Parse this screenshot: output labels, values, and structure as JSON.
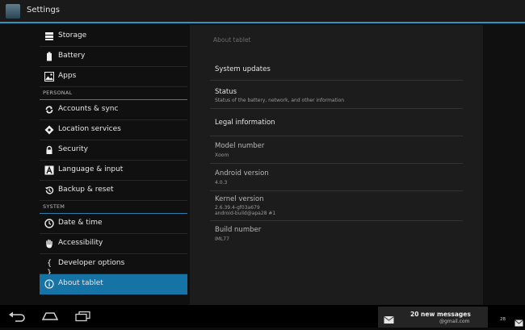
{
  "title": "Settings",
  "sidebar": {
    "items_a": [
      {
        "label": "Storage",
        "icon": "storage-icon"
      },
      {
        "label": "Battery",
        "icon": "battery-icon"
      },
      {
        "label": "Apps",
        "icon": "apps-icon"
      }
    ],
    "section_personal": "PERSONAL",
    "items_b": [
      {
        "label": "Accounts & sync",
        "icon": "sync-icon"
      },
      {
        "label": "Location services",
        "icon": "location-icon"
      },
      {
        "label": "Security",
        "icon": "lock-icon"
      },
      {
        "label": "Language & input",
        "icon": "language-icon"
      },
      {
        "label": "Backup & reset",
        "icon": "backup-icon"
      }
    ],
    "section_system": "SYSTEM",
    "items_c": [
      {
        "label": "Date & time",
        "icon": "clock-icon"
      },
      {
        "label": "Accessibility",
        "icon": "hand-icon"
      },
      {
        "label": "Developer options",
        "icon": "braces-icon"
      },
      {
        "label": "About tablet",
        "icon": "info-icon"
      }
    ]
  },
  "about": {
    "title": "About tablet",
    "system_updates": "System updates",
    "status_title": "Status",
    "status_sub": "Status of the battery, network, and other information",
    "legal": "Legal information",
    "model_label": "Model number",
    "model_value": "Xoom",
    "android_label": "Android version",
    "android_value": "4.0.3",
    "kernel_label": "Kernel version",
    "kernel_line1": "2.6.39.4-gf03a679",
    "kernel_line2": "android-build@apa28 #1",
    "build_label": "Build number",
    "build_value": "IML77"
  },
  "notification": {
    "count_text": "20 new messages",
    "account": "@gmail.com"
  },
  "status_bar": {
    "time": "28"
  },
  "colors": {
    "accent": "#2f96c4",
    "selected": "#1673a6"
  }
}
